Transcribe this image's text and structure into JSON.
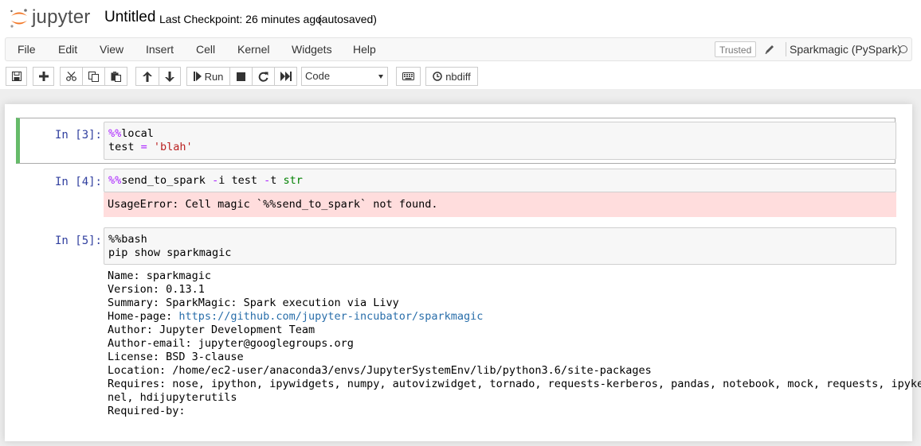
{
  "header": {
    "logo_text": "jupyter",
    "notebook_title": "Untitled",
    "checkpoint": "Last Checkpoint: 26 minutes ago",
    "autosave": "(autosaved)"
  },
  "menu": {
    "items": [
      "File",
      "Edit",
      "View",
      "Insert",
      "Cell",
      "Kernel",
      "Widgets",
      "Help"
    ],
    "trusted": "Trusted",
    "kernel_name": "Sparkmagic (PySpark)"
  },
  "toolbar": {
    "run_label": "Run",
    "cell_type": "Code",
    "nbdiff_label": "nbdiff"
  },
  "cells": [
    {
      "prompt": "In [3]:",
      "line1_magic": "%%",
      "line1_rest": "local",
      "line2_var": "test",
      "line2_op": " = ",
      "line2_str": "'blah'"
    },
    {
      "prompt": "In [4]:",
      "magic": "%%",
      "cmd": "send_to_spark ",
      "flag_i": "-",
      "arg_i": "i test ",
      "flag_t": "-",
      "arg_t": "t ",
      "type_kw": "str",
      "error": "UsageError: Cell magic `%%send_to_spark` not found."
    },
    {
      "prompt": "In [5]:",
      "line1": "%%bash",
      "line2": "pip show sparkmagic",
      "output_lines": [
        "Name: sparkmagic",
        "Version: 0.13.1",
        "Summary: SparkMagic: Spark execution via Livy",
        "Author: Jupyter Development Team",
        "Author-email: jupyter@googlegroups.org",
        "License: BSD 3-clause",
        "Location: /home/ec2-user/anaconda3/envs/JupyterSystemEnv/lib/python3.6/site-packages",
        "Requires: nose, ipython, ipywidgets, numpy, autovizwidget, tornado, requests-kerberos, pandas, notebook, mock, requests, ipyker",
        "nel, hdijupyterutils",
        "Required-by:"
      ],
      "homepage_label": "Home-page: ",
      "homepage_url": "https://github.com/jupyter-incubator/sparkmagic"
    }
  ],
  "colors": {
    "prompt": "#303f9f",
    "selected_border": "#66bb6a",
    "error_bg": "#ffdddd",
    "link": "#296eaa",
    "magic": "#aa22ff",
    "string": "#ba2121",
    "keyword": "#008000"
  },
  "icons": [
    "jupyter-logo-icon",
    "pencil-icon",
    "kernel-idle-icon",
    "save-icon",
    "plus-icon",
    "cut-icon",
    "copy-icon",
    "paste-icon",
    "arrow-up-icon",
    "arrow-down-icon",
    "step-forward-icon",
    "stop-icon",
    "restart-icon",
    "fast-forward-icon",
    "keyboard-icon",
    "clock-icon"
  ]
}
